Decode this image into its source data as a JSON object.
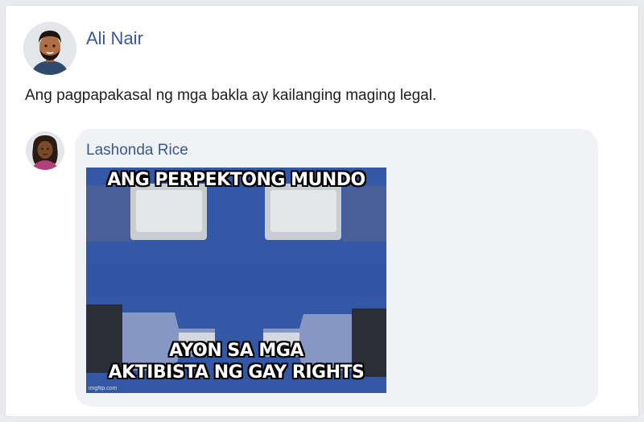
{
  "post": {
    "author": "Ali Nair",
    "text": "Ang pagpapakasal ng mga bakla ay kailanging maging legal."
  },
  "comment": {
    "author": "Lashonda Rice",
    "meme": {
      "top_text": "ANG PERPEKTONG MUNDO",
      "bottom_text_line1": "AYON SA MGA",
      "bottom_text_line2": "AKTIBISTA NG GAY RIGHTS",
      "watermark": "imgflip.com"
    }
  },
  "colors": {
    "name_link": "#385898",
    "meme_background": "#3358a6"
  }
}
